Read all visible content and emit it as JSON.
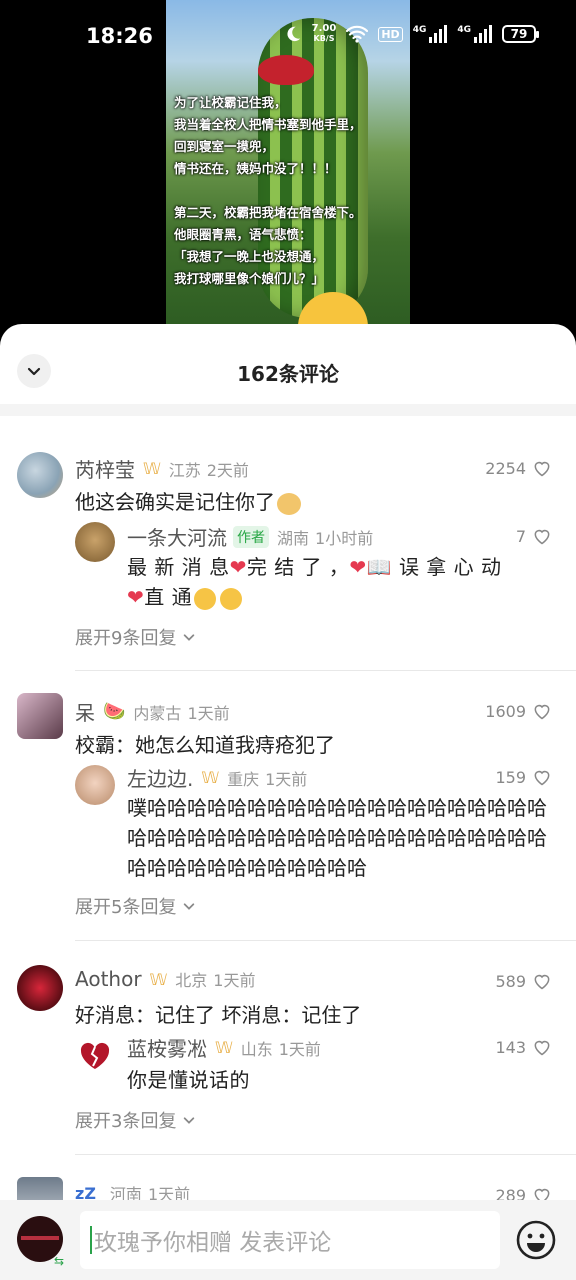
{
  "status": {
    "time": "18:26",
    "speed_value": "7.00",
    "speed_unit": "KB/S",
    "hd": "HD",
    "net1": "4G",
    "net2": "4G",
    "battery": "79"
  },
  "video": {
    "caption_lines": [
      "为了让校霸记住我，",
      "我当着全校人把情书塞到他手里，",
      "回到寝室一摸兜，",
      "情书还在，姨妈巾没了！！！",
      "",
      "第二天，校霸把我堵在宿舍楼下。",
      "他眼圈青黑，语气悲愤：",
      "「我想了一晚上也没想通，",
      "我打球哪里像个娘们儿？」"
    ]
  },
  "sheet": {
    "title": "162条评论"
  },
  "comments": [
    {
      "user": "芮梓莹",
      "region": "江苏",
      "time": "2天前",
      "likes": "2254",
      "text": "他这会确实是记住你了",
      "reply": {
        "user": "一条大河流",
        "tag": "作者",
        "region": "湖南",
        "time": "1小时前",
        "likes": "7",
        "text_a": "最 新 消 息",
        "text_b": "完 结 了 ，",
        "text_c": "误 拿 心 动",
        "text_d": "直 通"
      },
      "expand": "展开9条回复"
    },
    {
      "user": "呆",
      "region": "内蒙古",
      "time": "1天前",
      "likes": "1609",
      "text": "校霸：她怎么知道我痔疮犯了",
      "reply": {
        "user": "左边边.",
        "region": "重庆",
        "time": "1天前",
        "likes": "159",
        "text": "噗哈哈哈哈哈哈哈哈哈哈哈哈哈哈哈哈哈哈哈哈哈哈哈哈哈哈哈哈哈哈哈哈哈哈哈哈哈哈哈哈哈哈哈哈哈哈哈哈哈哈哈哈哈"
      },
      "expand": "展开5条回复"
    },
    {
      "user": "Aothor",
      "region": "北京",
      "time": "1天前",
      "likes": "589",
      "text": "好消息：记住了 坏消息：记住了",
      "reply": {
        "user": "蓝桉雾凇",
        "region": "山东",
        "time": "1天前",
        "likes": "143",
        "text": "你是懂说话的"
      },
      "expand": "展开3条回复"
    },
    {
      "user": "",
      "region": "河南",
      "time": "1天前",
      "likes": "289"
    }
  ],
  "input": {
    "placeholder": "玫瑰予你相赠 发表评论"
  },
  "colors": {
    "like_gray": "#888888",
    "author_green": "#28a745",
    "laurel_gold": "#e8b04a"
  },
  "icons": [
    "moon-icon",
    "wifi-icon",
    "signal-icon",
    "battery-icon",
    "chevron-down-icon",
    "heart-icon",
    "laurel-icon",
    "emoji-icon"
  ]
}
